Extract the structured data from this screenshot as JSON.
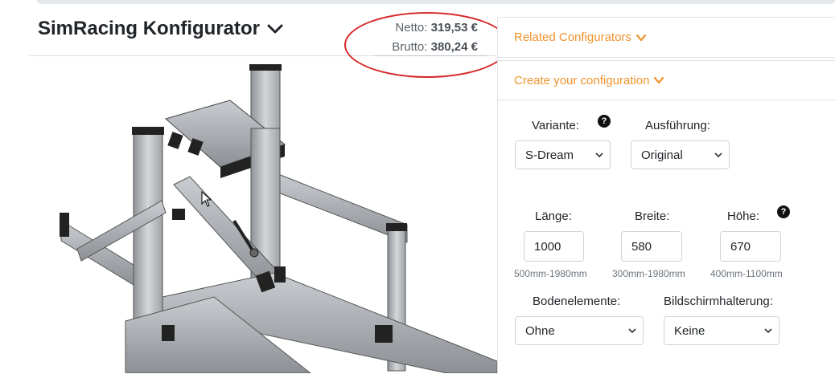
{
  "header": {
    "title": "SimRacing Konfigurator",
    "price_net_label": "Netto:",
    "price_net_value": "319,53 €",
    "price_gross_label": "Brutto:",
    "price_gross_value": "380,24 €"
  },
  "panel": {
    "related_label": "Related Configurators",
    "create_label": "Create your configuration"
  },
  "form": {
    "variante_label": "Variante:",
    "variante_value": "S-Dream",
    "ausfuehrung_label": "Ausführung:",
    "ausfuehrung_value": "Original",
    "laenge_label": "Länge:",
    "laenge_value": "1000",
    "laenge_hint": "500mm-1980mm",
    "breite_label": "Breite:",
    "breite_value": "580",
    "breite_hint": "300mm-1980mm",
    "hoehe_label": "Höhe:",
    "hoehe_value": "670",
    "hoehe_hint": "400mm-1100mm",
    "boden_label": "Bodenelemente:",
    "boden_value": "Ohne",
    "bildschirm_label": "Bildschirmhalterung:",
    "bildschirm_value": "Keine",
    "help_glyph": "?"
  },
  "colors": {
    "accent": "#f0922e",
    "annotation": "#d62828"
  }
}
